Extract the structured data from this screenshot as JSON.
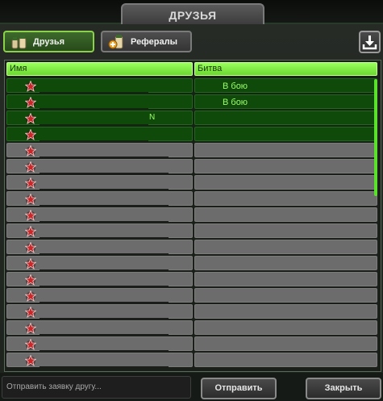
{
  "window": {
    "title": "ДРУЗЬЯ"
  },
  "tabs": [
    {
      "label": "Друзья",
      "active": true,
      "icon": "friends-icon"
    },
    {
      "label": "Рефералы",
      "active": false,
      "icon": "referrals-icon"
    }
  ],
  "toolbar": {
    "download_icon": "download-icon"
  },
  "table": {
    "columns": [
      "Имя",
      "Битва"
    ],
    "rows": [
      {
        "status": "online",
        "battle": "В бою",
        "name_suffix": ""
      },
      {
        "status": "online",
        "battle": "В бою",
        "name_suffix": ""
      },
      {
        "status": "online",
        "battle": "",
        "name_suffix": "N"
      },
      {
        "status": "online",
        "battle": "",
        "name_suffix": ""
      },
      {
        "status": "offline",
        "battle": "",
        "name_suffix": ""
      },
      {
        "status": "offline",
        "battle": "",
        "name_suffix": ""
      },
      {
        "status": "offline",
        "battle": "",
        "name_suffix": ""
      },
      {
        "status": "offline",
        "battle": "",
        "name_suffix": ""
      },
      {
        "status": "offline",
        "battle": "",
        "name_suffix": ""
      },
      {
        "status": "offline",
        "battle": "",
        "name_suffix": ""
      },
      {
        "status": "offline",
        "battle": "",
        "name_suffix": ""
      },
      {
        "status": "offline",
        "battle": "",
        "name_suffix": ""
      },
      {
        "status": "offline",
        "battle": "",
        "name_suffix": ""
      },
      {
        "status": "offline",
        "battle": "",
        "name_suffix": ""
      },
      {
        "status": "offline",
        "battle": "",
        "name_suffix": ""
      },
      {
        "status": "offline",
        "battle": "",
        "name_suffix": ""
      },
      {
        "status": "offline",
        "battle": "",
        "name_suffix": ""
      },
      {
        "status": "offline",
        "battle": "",
        "name_suffix": ""
      }
    ]
  },
  "footer": {
    "invite_placeholder": "Отправить заявку другу...",
    "send_label": "Отправить",
    "close_label": "Закрыть"
  },
  "colors": {
    "accent": "#6cd830",
    "online_row": "#0f4a0a",
    "offline_row": "#6c6c6c",
    "battle_text": "#9bff6a"
  }
}
